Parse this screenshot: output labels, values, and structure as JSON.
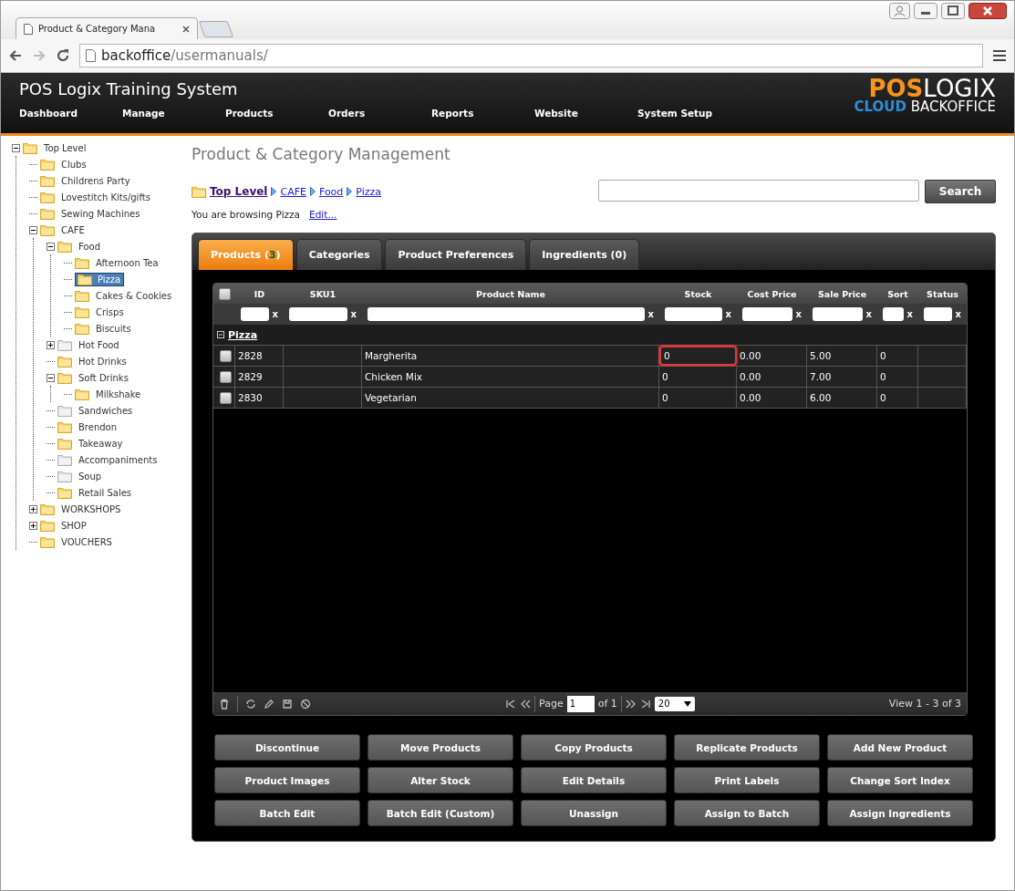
{
  "browser": {
    "tab_title": "Product & Category Mana",
    "url_host": "backoffice",
    "url_path": "/usermanuals/"
  },
  "header": {
    "title": "POS Logix Training System",
    "logo": {
      "word1": "POS",
      "word2": "LOGIX",
      "word3": "CLOUD",
      "word4": "BACKOFFICE"
    },
    "nav": [
      "Dashboard",
      "Manage",
      "Products",
      "Orders",
      "Reports",
      "Website",
      "System Setup"
    ]
  },
  "tree": [
    {
      "label": "Top Level",
      "expanded": true,
      "selected": false,
      "inactive": false,
      "children": [
        {
          "label": "Clubs",
          "selected": false,
          "inactive": false
        },
        {
          "label": "Childrens Party",
          "selected": false,
          "inactive": false
        },
        {
          "label": "Lovestitch Kits/gifts",
          "selected": false,
          "inactive": false
        },
        {
          "label": "Sewing Machines",
          "selected": false,
          "inactive": false
        },
        {
          "label": "CAFE",
          "expanded": true,
          "selected": false,
          "inactive": false,
          "children": [
            {
              "label": "Food",
              "expanded": true,
              "selected": false,
              "inactive": false,
              "children": [
                {
                  "label": "Afternoon Tea",
                  "selected": false,
                  "inactive": false
                },
                {
                  "label": "Pizza",
                  "selected": true,
                  "inactive": false
                },
                {
                  "label": "Cakes & Cookies",
                  "selected": false,
                  "inactive": false
                },
                {
                  "label": "Crisps",
                  "selected": false,
                  "inactive": false
                },
                {
                  "label": "Biscuits",
                  "selected": false,
                  "inactive": false
                }
              ]
            },
            {
              "label": "Hot Food",
              "expanded": false,
              "selected": false,
              "inactive": true
            },
            {
              "label": "Hot Drinks",
              "selected": false,
              "inactive": false
            },
            {
              "label": "Soft Drinks",
              "expanded": true,
              "selected": false,
              "inactive": false,
              "children": [
                {
                  "label": "Milkshake",
                  "selected": false,
                  "inactive": false
                }
              ]
            },
            {
              "label": "Sandwiches",
              "selected": false,
              "inactive": true
            },
            {
              "label": "Brendon",
              "selected": false,
              "inactive": false
            },
            {
              "label": "Takeaway",
              "selected": false,
              "inactive": false
            },
            {
              "label": "Accompaniments",
              "selected": false,
              "inactive": true
            },
            {
              "label": "Soup",
              "selected": false,
              "inactive": true
            },
            {
              "label": "Retail Sales",
              "selected": false,
              "inactive": false
            }
          ]
        },
        {
          "label": "WORKSHOPS",
          "expanded": false,
          "selected": false,
          "inactive": false
        },
        {
          "label": "SHOP",
          "expanded": false,
          "selected": false,
          "inactive": false
        },
        {
          "label": "VOUCHERS",
          "selected": false,
          "inactive": false
        }
      ]
    }
  ],
  "page_title": "Product & Category Management",
  "breadcrumb": [
    "Top Level",
    "CAFE",
    "Food",
    "Pizza"
  ],
  "browsing": {
    "text": "You are browsing Pizza",
    "link": "Edit..."
  },
  "search": {
    "button": "Search"
  },
  "tabs": [
    {
      "label": "Products (",
      "count": "3",
      "label_end": ")",
      "selected": true
    },
    {
      "label": "Categories",
      "selected": false
    },
    {
      "label": "Product Preferences",
      "selected": false
    },
    {
      "label": "Ingredients (0)",
      "selected": false
    }
  ],
  "table": {
    "all_checked": false,
    "columns": [
      {
        "label": "ID",
        "clear": "x"
      },
      {
        "label": "SKU1",
        "clear": "x"
      },
      {
        "label": "Product Name",
        "clear": "x"
      },
      {
        "label": "Stock",
        "clear": "x"
      },
      {
        "label": "Cost Price",
        "clear": "x"
      },
      {
        "label": "Sale Price",
        "clear": "x"
      },
      {
        "label": "Sort",
        "clear": "x"
      },
      {
        "label": "Status",
        "clear": "x"
      }
    ],
    "group": "Pizza",
    "rows": [
      {
        "checked": false,
        "stock_editing": true,
        "id": "2828",
        "product_name": "Margherita",
        "stock": "0",
        "cost_price": "0.00",
        "sale_price": "5.00",
        "sort": "0"
      },
      {
        "checked": false,
        "stock_editing": false,
        "id": "2829",
        "product_name": "Chicken Mix",
        "stock": "0",
        "cost_price": "0.00",
        "sale_price": "7.00",
        "sort": "0"
      },
      {
        "checked": false,
        "stock_editing": false,
        "id": "2830",
        "product_name": "Vegetarian",
        "stock": "0",
        "cost_price": "0.00",
        "sale_price": "6.00",
        "sort": "0"
      }
    ]
  },
  "pager": {
    "page_label": "Page",
    "page": "1",
    "of": "of 1",
    "page_size": "20",
    "summary": "View 1 - 3 of 3"
  },
  "buttons": [
    "Discontinue",
    "Move Products",
    "Copy Products",
    "Replicate Products",
    "Add New Product",
    "Product Images",
    "Alter Stock",
    "Edit Details",
    "Print Labels",
    "Change Sort Index",
    "Batch Edit",
    "Batch Edit (Custom)",
    "Unassign",
    "Assign to Batch",
    "Assign Ingredients"
  ]
}
